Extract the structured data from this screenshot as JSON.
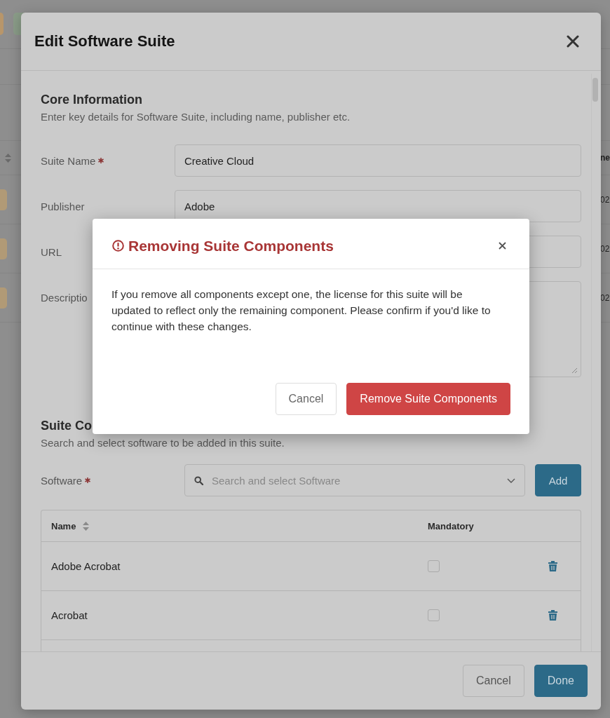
{
  "background_page": {
    "column_header": "ne",
    "rows": [
      {
        "cell": "02"
      },
      {
        "cell": "02"
      },
      {
        "cell": "02"
      }
    ]
  },
  "dialog": {
    "title": "Edit Software Suite",
    "core": {
      "title": "Core Information",
      "subtitle": "Enter key details for Software Suite, including name, publisher etc.",
      "fields": [
        {
          "label": "Suite Name",
          "required": true,
          "kind": "input",
          "value": "Creative Cloud"
        },
        {
          "label": "Publisher",
          "required": false,
          "kind": "input",
          "value": "Adobe"
        },
        {
          "label": "URL",
          "required": false,
          "kind": "input"
        },
        {
          "label": "Descriptio",
          "required": false,
          "kind": "textarea"
        }
      ]
    },
    "components": {
      "title": "Suite Co",
      "subtitle": "Search and select software to be added in this suite.",
      "software": {
        "label": "Software",
        "required": true,
        "placeholder": "Search and select Software"
      },
      "add_button": "Add",
      "table": {
        "columns": [
          "Name",
          "Mandatory"
        ],
        "rows": [
          {
            "name": "Adobe Acrobat",
            "mandatory": false
          },
          {
            "name": "Acrobat",
            "mandatory": false
          }
        ]
      }
    },
    "footer": {
      "buttons": [
        {
          "label": "Cancel",
          "kind": "secondary"
        },
        {
          "label": "Done",
          "kind": "primary"
        }
      ]
    }
  },
  "confirm": {
    "title": "Removing Suite Components",
    "message": "If you remove all components except one, the license for this suite will be updated to reflect only the remaining component. Please confirm if you'd like to continue with these changes.",
    "buttons": [
      {
        "label": "Cancel",
        "kind": "secondary"
      },
      {
        "label": "Remove Suite Components",
        "kind": "danger"
      }
    ]
  }
}
